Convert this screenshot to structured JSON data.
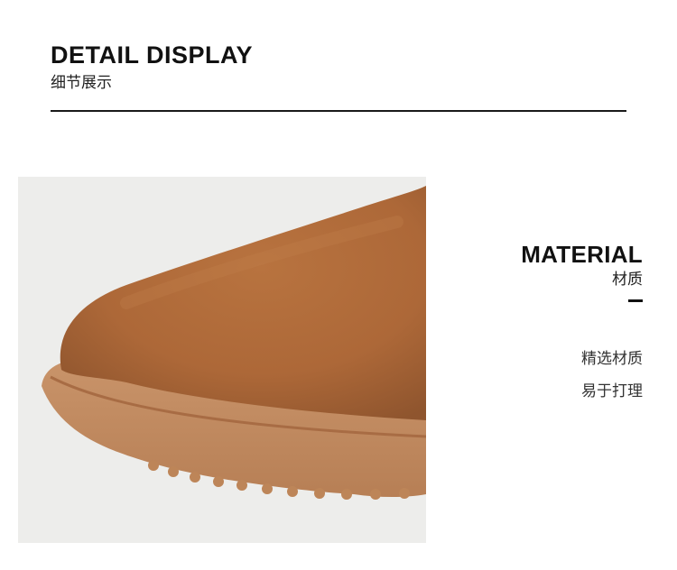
{
  "header": {
    "title": "DETAIL DISPLAY",
    "subtitle": "细节展示"
  },
  "photo": {
    "subject": "boot-toe-detail",
    "colors": {
      "background": "#ededeb",
      "suede": "#b06a3c",
      "sole": "#c28a5f"
    }
  },
  "material": {
    "title": "MATERIAL",
    "subtitle": "材质",
    "lines": [
      "精选材质",
      "易于打理"
    ]
  }
}
